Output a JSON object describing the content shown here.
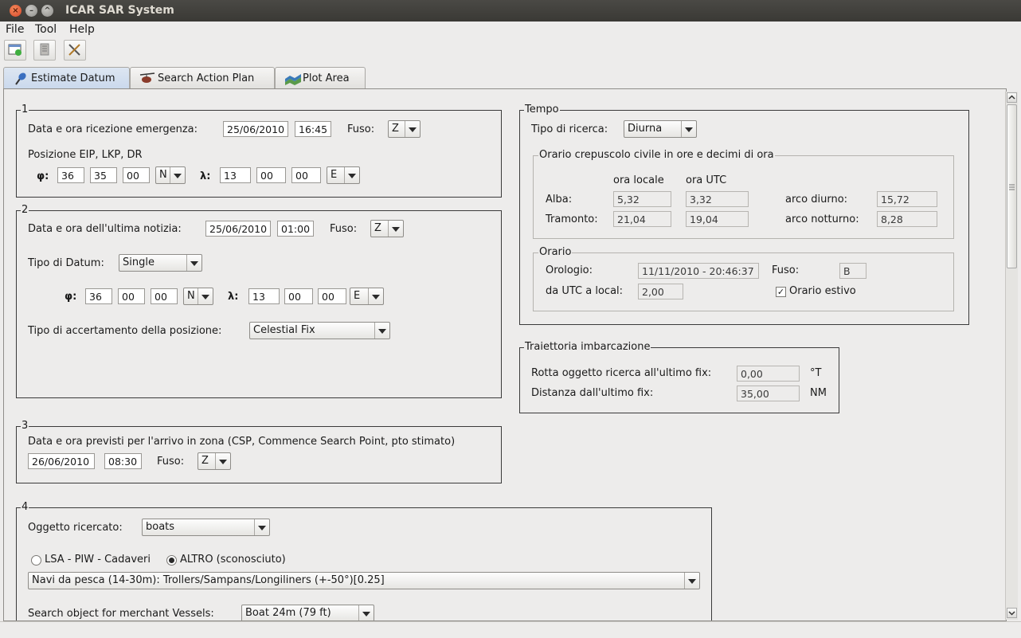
{
  "window": {
    "title": "ICAR SAR System"
  },
  "menu": [
    "File",
    "Tool",
    "Help"
  ],
  "tabs": [
    {
      "label": "Estimate Datum",
      "icon": "pin-icon"
    },
    {
      "label": "Search Action Plan",
      "icon": "helicopter-icon"
    },
    {
      "label": "Plot Area",
      "icon": "map-icon"
    }
  ],
  "g1": {
    "title": "1",
    "recv_label": "Data e ora ricezione emergenza:",
    "date": "25/06/2010",
    "time": "16:45",
    "fuso_label": "Fuso:",
    "fuso": "Z",
    "pos_label": "Posizione EIP, LKP, DR",
    "phi_label": "φ:",
    "lat_deg": "36",
    "lat_min": "35",
    "lat_sec": "00",
    "lat_hem": "N",
    "lambda_label": "λ:",
    "lon_deg": "13",
    "lon_min": "00",
    "lon_sec": "00",
    "lon_hem": "E"
  },
  "g2": {
    "title": "2",
    "last_label": "Data e ora dell'ultima notizia:",
    "date": "25/06/2010",
    "time": "01:00",
    "fuso_label": "Fuso:",
    "fuso": "Z",
    "datum_label": "Tipo di Datum:",
    "datum": "Single",
    "phi_label": "φ:",
    "lat_deg": "36",
    "lat_min": "00",
    "lat_sec": "00",
    "lat_hem": "N",
    "lambda_label": "λ:",
    "lon_deg": "13",
    "lon_min": "00",
    "lon_sec": "00",
    "lon_hem": "E",
    "acc_label": "Tipo di accertamento della posizione:",
    "acc": "Celestial Fix"
  },
  "g3": {
    "title": "3",
    "label": "Data e ora previsti per l'arrivo in zona (CSP, Commence Search Point, pto stimato)",
    "date": "26/06/2010",
    "time": "08:30",
    "fuso_label": "Fuso:",
    "fuso": "Z"
  },
  "g4": {
    "title": "4",
    "obj_label": "Oggetto ricercato:",
    "obj": "boats",
    "radio1": "LSA - PIW - Cadaveri",
    "radio2": "ALTRO (sconosciuto)",
    "type": "Navi da pesca (14-30m): Trollers/Sampans/Longiliners (+-50°)[0.25]",
    "merchant_label": "Search object for merchant Vessels:",
    "merchant": "Boat 24m (79 ft)"
  },
  "tempo": {
    "title": "Tempo",
    "tipo_label": "Tipo di ricerca:",
    "tipo": "Diurna",
    "twilight": {
      "title": "Orario crepuscolo civile in ore e decimi di ora",
      "col_local": "ora locale",
      "col_utc": "ora UTC",
      "alba_label": "Alba:",
      "alba_local": "5,32",
      "alba_utc": "3,32",
      "tram_label": "Tramonto:",
      "tram_local": "21,04",
      "tram_utc": "19,04",
      "diurno_label": "arco diurno:",
      "diurno": "15,72",
      "notturno_label": "arco notturno:",
      "notturno": "8,28"
    },
    "orario": {
      "title": "Orario",
      "orologio_label": "Orologio:",
      "orologio": "11/11/2010 - 20:46:37",
      "fuso_label": "Fuso:",
      "fuso": "B",
      "utc_label": "da UTC a local:",
      "utc": "2,00",
      "estivo_label": "Orario estivo",
      "estivo_check": "✓"
    }
  },
  "traj": {
    "title": "Traiettoria imbarcazione",
    "rotta_label": "Rotta oggetto ricerca all'ultimo fix:",
    "rotta": "0,00",
    "rotta_unit": "°T",
    "dist_label": "Distanza dall'ultimo fix:",
    "dist": "35,00",
    "dist_unit": "NM"
  }
}
